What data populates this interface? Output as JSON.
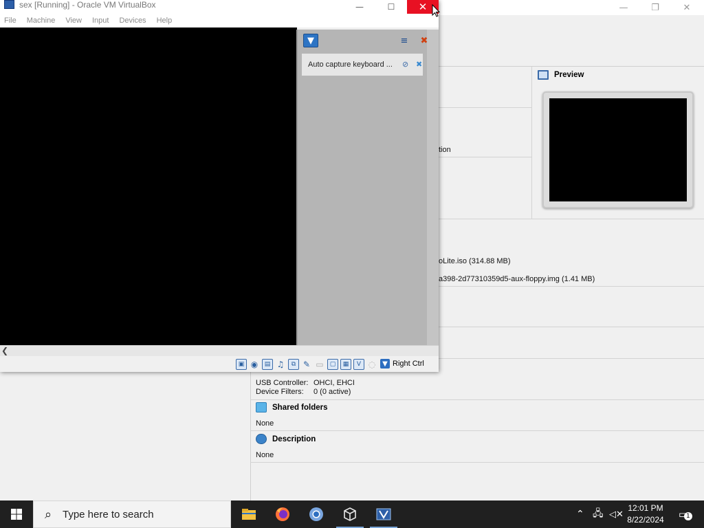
{
  "vm_window": {
    "title": "sex [Running] - Oracle VM VirtualBox",
    "menu": [
      "File",
      "Machine",
      "View",
      "Input",
      "Devices",
      "Help"
    ],
    "controls": {
      "minimize": "—",
      "maximize": "☐",
      "close": "✕"
    },
    "notification": {
      "message": "Auto capture keyboard ..."
    },
    "statusbar": {
      "host_key": "Right Ctrl"
    }
  },
  "manager": {
    "controls": {
      "minimize": "—",
      "restore": "❐",
      "close": "✕"
    },
    "details": {
      "partial_text_1": "tion",
      "storage_line_1": "oLite.iso (314.88 MB)",
      "storage_line_2": "a398-2d77310359d5-aux-floppy.img (1.41 MB)",
      "usb": {
        "controller_label": "USB Controller:",
        "controller_value": "OHCI, EHCI",
        "filters_label": "Device Filters:",
        "filters_value": "0 (0 active)"
      },
      "shared_folders": {
        "title": "Shared folders",
        "value": "None"
      },
      "description": {
        "title": "Description",
        "value": "None"
      }
    },
    "preview": {
      "title": "Preview"
    }
  },
  "taskbar": {
    "search_placeholder": "Type here to search",
    "time": "12:01 PM",
    "date": "8/22/2024",
    "notification_count": "1",
    "apps": [
      "file-explorer",
      "firefox",
      "chromium",
      "virtualbox-box",
      "virtualbox"
    ]
  },
  "colors": {
    "close_red": "#e81123",
    "taskbar": "#202020",
    "vbox_blue": "#2d74c4"
  }
}
